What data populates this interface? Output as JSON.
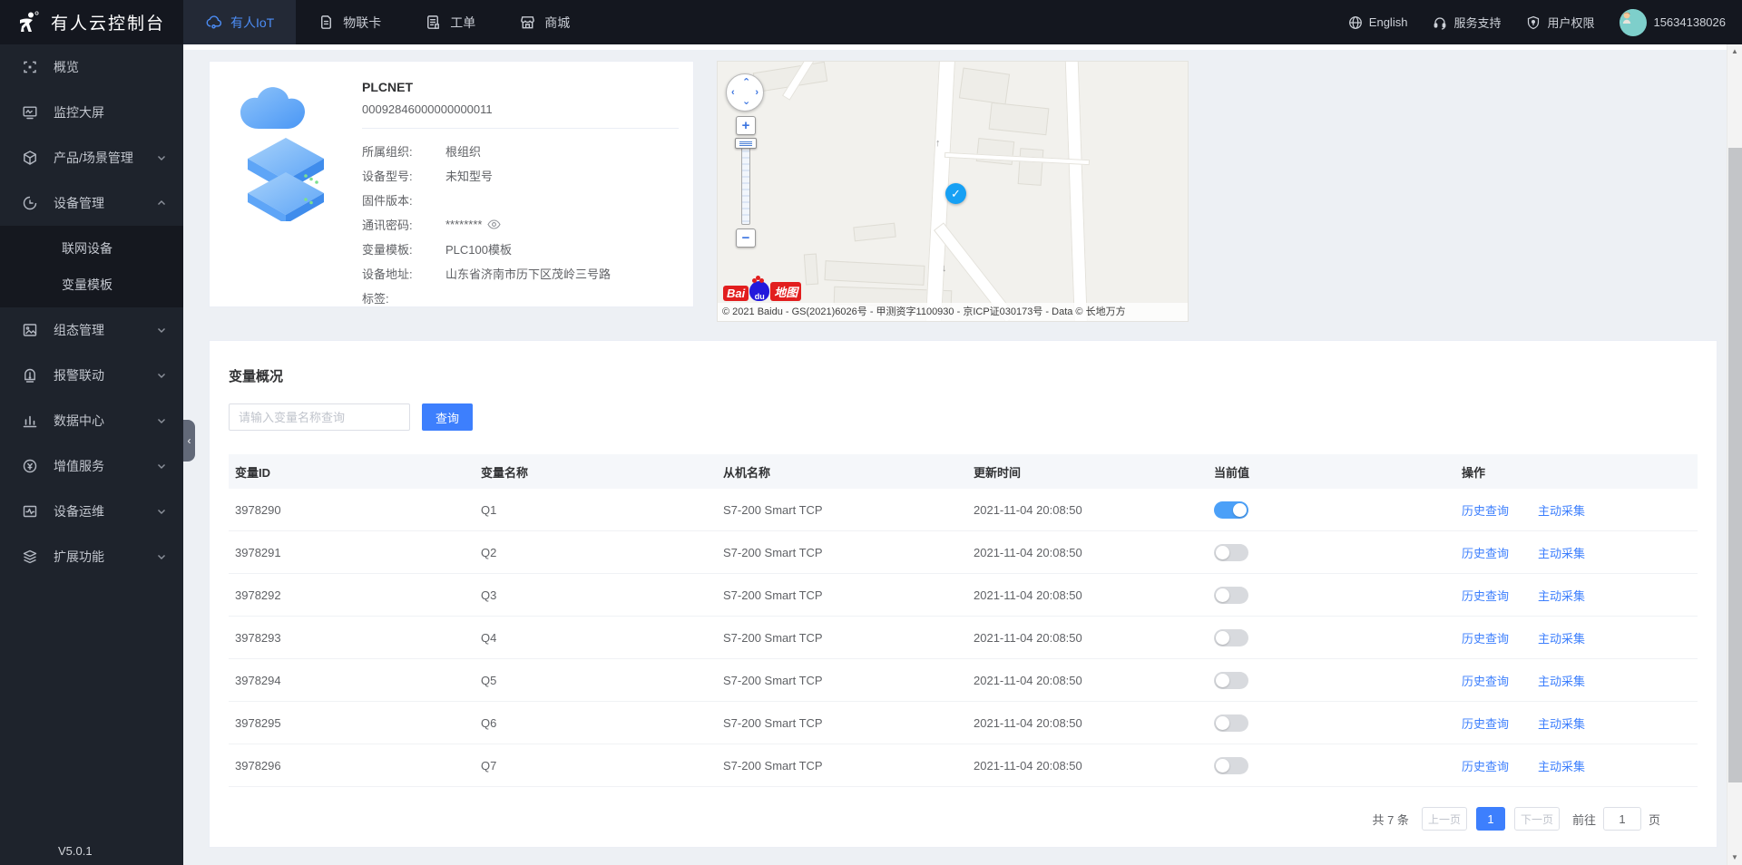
{
  "header": {
    "brand": "有人云控制台",
    "tabs": [
      {
        "label": "有人IoT"
      },
      {
        "label": "物联卡"
      },
      {
        "label": "工单"
      },
      {
        "label": "商城"
      }
    ],
    "right": {
      "language": "English",
      "support": "服务支持",
      "permissions": "用户权限",
      "phone": "15634138026"
    }
  },
  "sidebar": {
    "items": [
      {
        "label": "概览"
      },
      {
        "label": "监控大屏"
      },
      {
        "label": "产品/场景管理"
      },
      {
        "label": "设备管理",
        "children": [
          "联网设备",
          "变量模板"
        ]
      },
      {
        "label": "组态管理"
      },
      {
        "label": "报警联动"
      },
      {
        "label": "数据中心"
      },
      {
        "label": "增值服务"
      },
      {
        "label": "设备运维"
      },
      {
        "label": "扩展功能"
      }
    ],
    "version": "V5.0.1"
  },
  "device": {
    "name": "PLCNET",
    "id": "00092846000000000011",
    "fields": [
      {
        "label": "所属组织:",
        "value": "根组织"
      },
      {
        "label": "设备型号:",
        "value": "未知型号"
      },
      {
        "label": "固件版本:",
        "value": ""
      },
      {
        "label": "通讯密码:",
        "value": "********"
      },
      {
        "label": "变量模板:",
        "value": "PLC100模板"
      },
      {
        "label": "设备地址:",
        "value": "山东省济南市历下区茂岭三号路"
      },
      {
        "label": "标签:",
        "value": ""
      }
    ]
  },
  "map": {
    "logo": {
      "part1": "Bai",
      "part2": "du",
      "part3": "地图"
    },
    "attribution": "© 2021 Baidu - GS(2021)6026号 - 甲测资字1100930 - 京ICP证030173号 - Data © 长地万方"
  },
  "variables": {
    "title": "变量概况",
    "search_placeholder": "请输入变量名称查询",
    "search_button": "查询",
    "table": {
      "columns": [
        "变量ID",
        "变量名称",
        "从机名称",
        "更新时间",
        "当前值",
        "操作"
      ],
      "actions": [
        "历史查询",
        "主动采集"
      ],
      "rows": [
        {
          "id": "3978290",
          "name": "Q1",
          "slave": "S7-200 Smart TCP",
          "updated": "2021-11-04 20:08:50",
          "on": true
        },
        {
          "id": "3978291",
          "name": "Q2",
          "slave": "S7-200 Smart TCP",
          "updated": "2021-11-04 20:08:50",
          "on": false
        },
        {
          "id": "3978292",
          "name": "Q3",
          "slave": "S7-200 Smart TCP",
          "updated": "2021-11-04 20:08:50",
          "on": false
        },
        {
          "id": "3978293",
          "name": "Q4",
          "slave": "S7-200 Smart TCP",
          "updated": "2021-11-04 20:08:50",
          "on": false
        },
        {
          "id": "3978294",
          "name": "Q5",
          "slave": "S7-200 Smart TCP",
          "updated": "2021-11-04 20:08:50",
          "on": false
        },
        {
          "id": "3978295",
          "name": "Q6",
          "slave": "S7-200 Smart TCP",
          "updated": "2021-11-04 20:08:50",
          "on": false
        },
        {
          "id": "3978296",
          "name": "Q7",
          "slave": "S7-200 Smart TCP",
          "updated": "2021-11-04 20:08:50",
          "on": false
        }
      ]
    },
    "pagination": {
      "total": "共 7 条",
      "prev": "上一页",
      "page": "1",
      "next": "下一页",
      "goto_prefix": "前往",
      "goto_value": "1",
      "goto_suffix": "页"
    }
  },
  "colors": {
    "accent": "#3D7FFD",
    "toggle_on": "#4BA0F8"
  }
}
